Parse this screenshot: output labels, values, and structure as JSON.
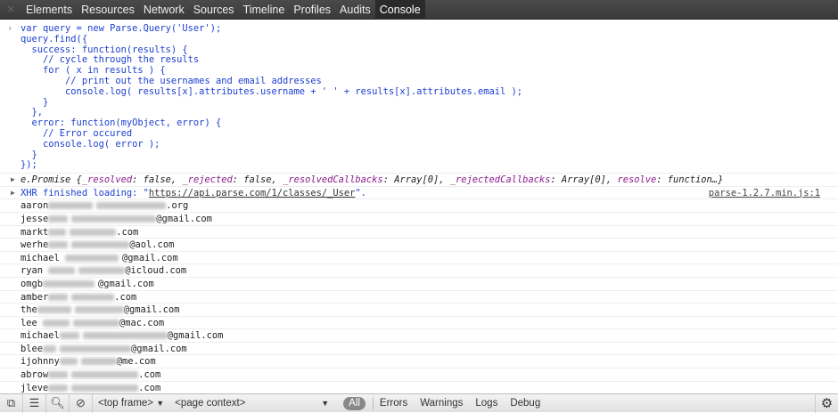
{
  "tabs": [
    "Elements",
    "Resources",
    "Network",
    "Sources",
    "Timeline",
    "Profiles",
    "Audits",
    "Console"
  ],
  "code": "var query = new Parse.Query('User');\nquery.find({\n  success: function(results) {\n    // cycle through the results\n    for ( x in results ) {\n        // print out the usernames and email addresses\n        console.log( results[x].attributes.username + ' ' + results[x].attributes.email );\n    }\n  },\n  error: function(myObject, error) {\n    // Error occured\n    console.log( error );\n  }\n});",
  "promise": {
    "name": "e.Promise {",
    "p1": "_resolved",
    "v1": ": false, ",
    "p2": "_rejected",
    "v2": ": false, ",
    "p3": "_resolvedCallbacks",
    "v3": ": Array[0], ",
    "p4": "_rejectedCallbacks",
    "v4": ": Array[0], ",
    "p5": "resolve",
    "v5": ": function…}"
  },
  "xhr": {
    "label": "XHR finished loading: ",
    "q1": "\"",
    "url": "https://api.parse.com/1/classes/_User",
    "q2": "\".",
    "source": "parse-1.2.7.min.js:1"
  },
  "rows": [
    {
      "prefix": "aaron",
      "suffix": ".org"
    },
    {
      "prefix": "jesse",
      "suffix": "@gmail.com"
    },
    {
      "prefix": "markt",
      "suffix": ".com"
    },
    {
      "prefix": "werhe",
      "suffix": "@aol.com"
    },
    {
      "prefix": "michael ",
      "suffix": "@gmail.com"
    },
    {
      "prefix": "ryan ",
      "suffix": "@icloud.com"
    },
    {
      "prefix": "omgb",
      "suffix": "@gmail.com"
    },
    {
      "prefix": "amber",
      "suffix": ".com"
    },
    {
      "prefix": "the",
      "suffix": "@gmail.com"
    },
    {
      "prefix": "lee ",
      "suffix": "@mac.com"
    },
    {
      "prefix": "michael",
      "suffix": "@gmail.com"
    },
    {
      "prefix": "blee",
      "suffix": "@gmail.com"
    },
    {
      "prefix": "ijohnny",
      "suffix": "@me.com"
    },
    {
      "prefix": "abrow",
      "suffix": ".com"
    },
    {
      "prefix": "jleve",
      "suffix": ".com"
    }
  ],
  "bottom": {
    "frame": "<top frame>",
    "context": "<page context>",
    "all": "All",
    "filters": [
      "Errors",
      "Warnings",
      "Logs",
      "Debug"
    ]
  }
}
